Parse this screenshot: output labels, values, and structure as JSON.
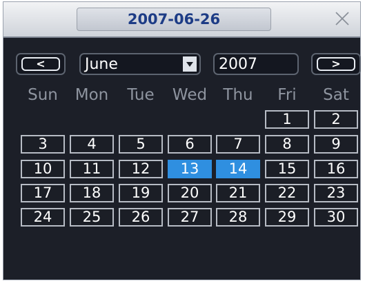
{
  "window": {
    "title": "2007-06-26"
  },
  "nav": {
    "prev_label": "<",
    "next_label": ">",
    "month_value": "June",
    "year_value": "2007"
  },
  "weekdays": [
    "Sun",
    "Mon",
    "Tue",
    "Wed",
    "Thu",
    "Fri",
    "Sat"
  ],
  "calendar": {
    "days": [
      "1",
      "2",
      "3",
      "4",
      "5",
      "6",
      "7",
      "8",
      "9",
      "10",
      "11",
      "12",
      "13",
      "14",
      "15",
      "16",
      "17",
      "18",
      "19",
      "20",
      "21",
      "22",
      "23",
      "24",
      "25",
      "26",
      "27",
      "28",
      "29",
      "30"
    ],
    "highlighted_days": [
      "13",
      "14"
    ],
    "first_weekday_index": 5
  },
  "colors": {
    "title_text": "#1d3c86",
    "highlight": "#2f8fe0",
    "weekday_text": "#8e949f"
  }
}
